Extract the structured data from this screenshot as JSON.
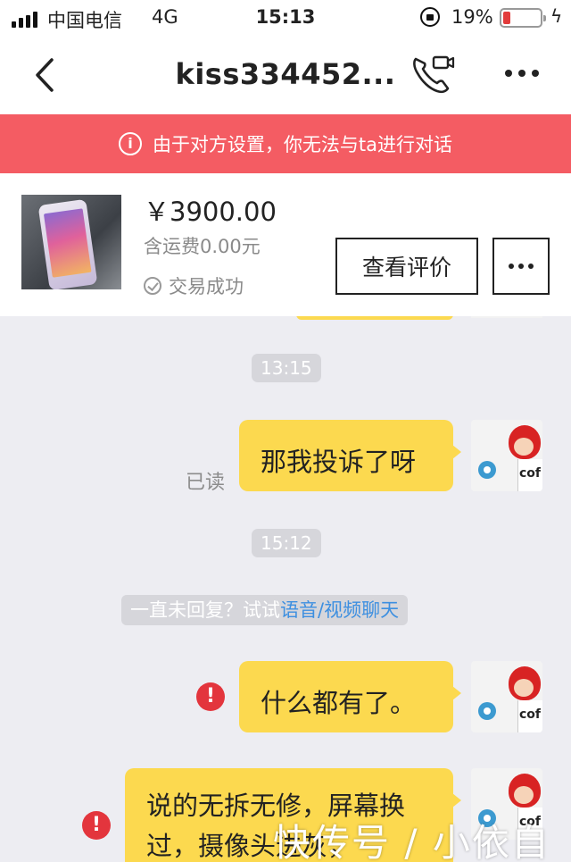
{
  "status_bar": {
    "carrier": "中国电信",
    "network": "4G",
    "time": "15:13",
    "battery_percent": "19%",
    "battery_level": 0.19,
    "charge_icon": "lightning-icon"
  },
  "nav": {
    "title": "kiss334452...",
    "back_icon": "chevron-left-icon",
    "call_icon": "phone-video-icon",
    "more_icon": "more-dots-icon"
  },
  "banner": {
    "text": "由于对方设置，你无法与ta进行对话",
    "icon": "info-icon",
    "color": "#f45c63"
  },
  "product": {
    "price": "￥3900.00",
    "shipping": "含运费0.00元",
    "status": "交易成功",
    "review_button": "查看评价",
    "more_icon": "more-dots-icon"
  },
  "messages": {
    "time_1": "13:15",
    "msg_1": "那我投诉了呀",
    "read_1": "已读",
    "time_2": "15:12",
    "hint_prefix": "一直未回复？试试",
    "hint_link": "语音/视频聊天",
    "msg_2": "什么都有了。",
    "msg_3": "说的无拆无修，屏幕换过，摄像头进灰，",
    "error_icon": "error-icon",
    "avatar_cup_text": "cof"
  },
  "colors": {
    "bubble": "#fcd94f",
    "background": "#ededf2",
    "error": "#e3353d",
    "link": "#3d8fe0"
  },
  "watermark": "快传号 / 小依自"
}
